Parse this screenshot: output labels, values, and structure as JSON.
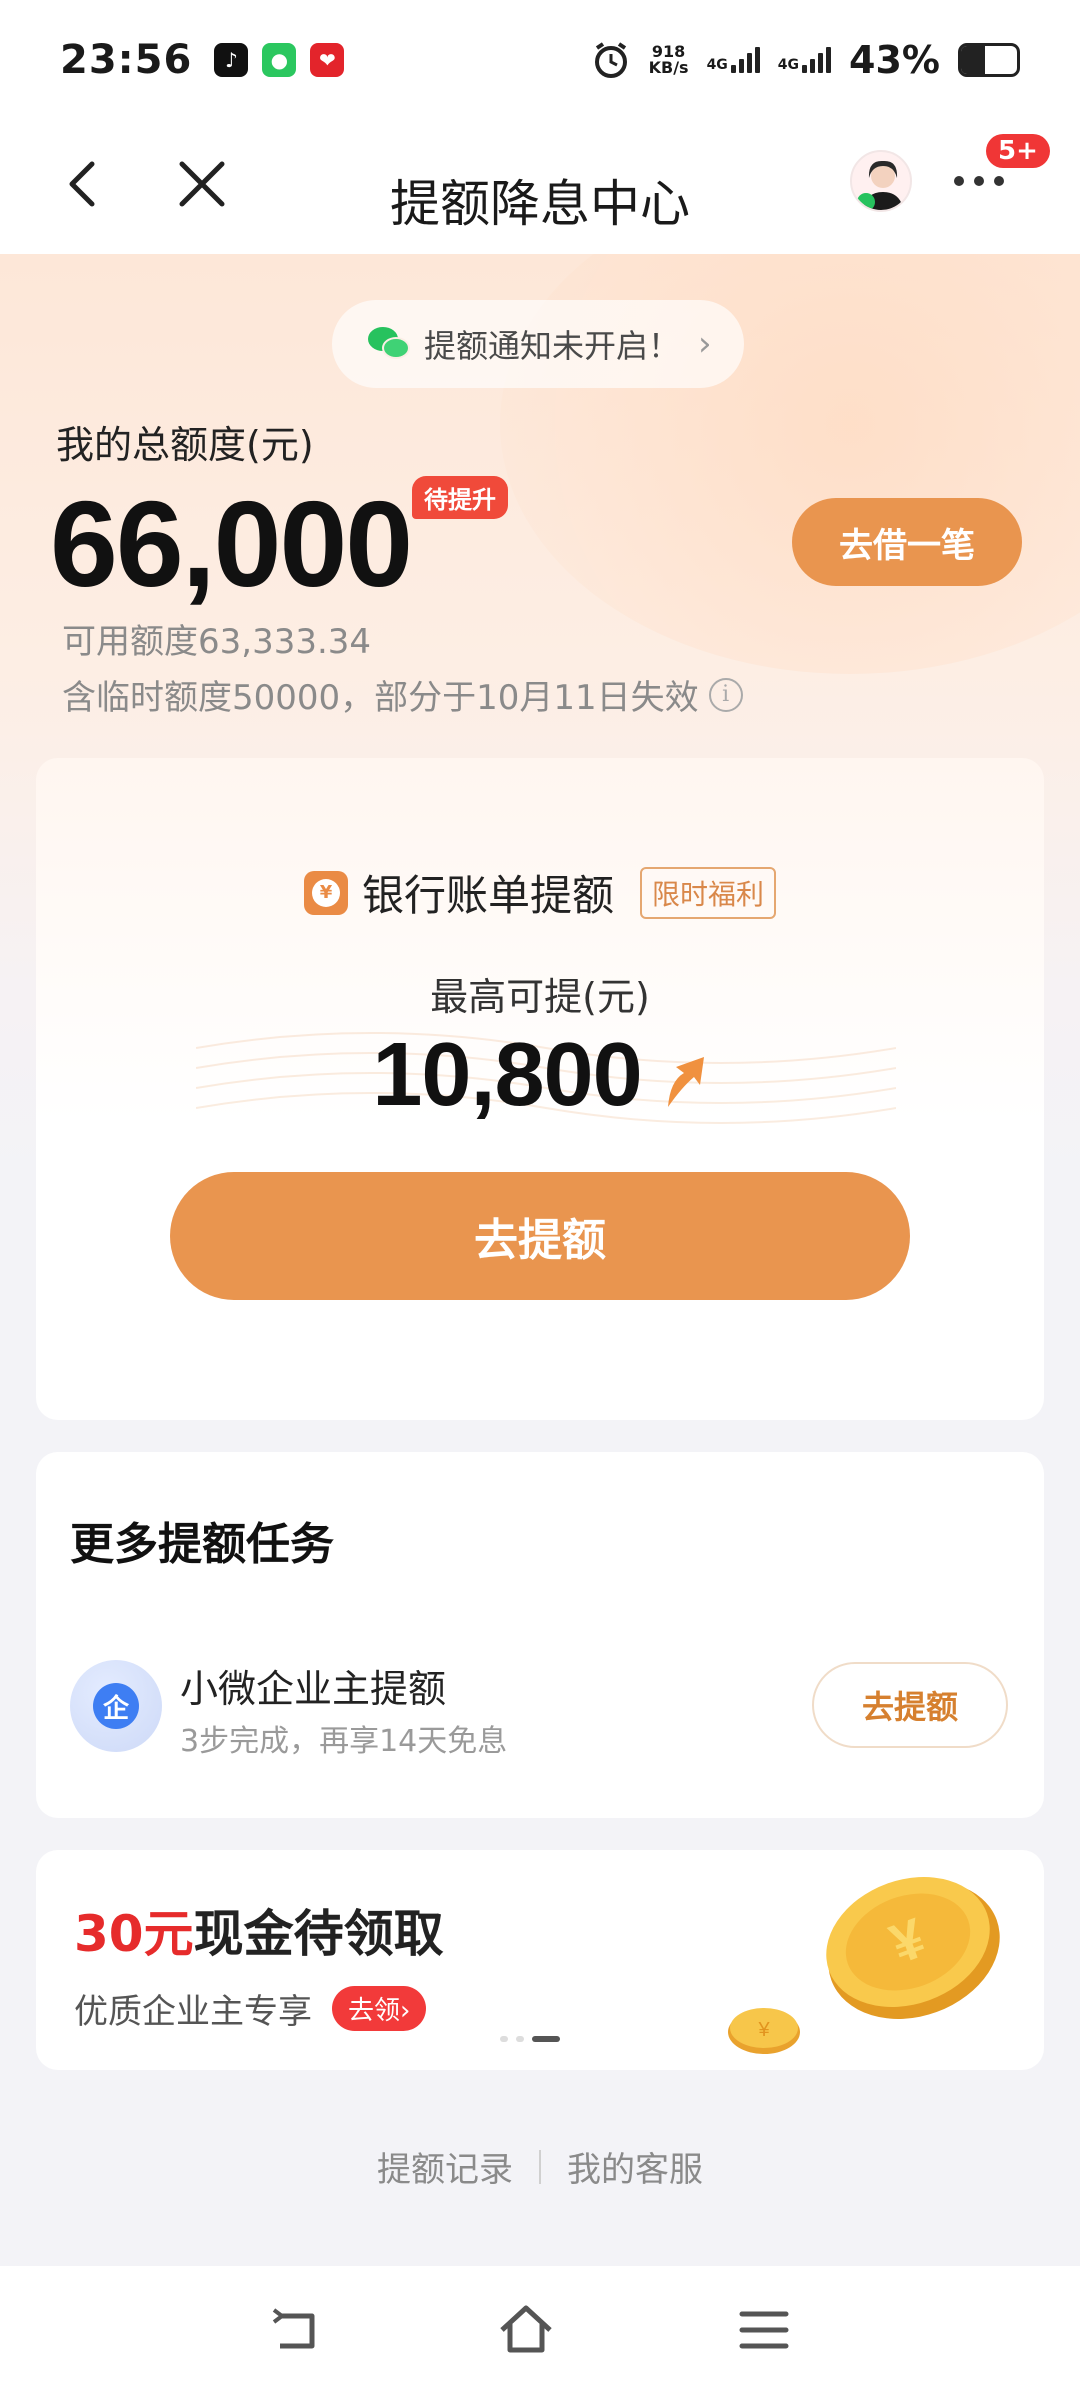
{
  "status_bar": {
    "time": "23:56",
    "net_speed_value": "918",
    "net_speed_unit": "KB/s",
    "network_1": "4G",
    "network_2": "4G",
    "battery_percent": "43%",
    "battery_level": 0.43,
    "app_icons": [
      "douyin-icon",
      "wechat-icon",
      "jd-icon"
    ]
  },
  "nav": {
    "title": "提额降息中心",
    "badge": "5+"
  },
  "hero": {
    "notify_text": "提额通知未开启！",
    "total_label": "我的总额度(元)",
    "total_amount": "66,000",
    "pending_tag": "待提升",
    "borrow_button": "去借一笔",
    "available_line": "可用额度63,333.34",
    "temporary_line": "含临时额度50000，部分于10月11日失效"
  },
  "raise_card": {
    "title": "银行账单提额",
    "limited_tag": "限时福利",
    "max_label": "最高可提(元)",
    "max_amount": "10,800",
    "button": "去提额"
  },
  "tasks_card": {
    "title": "更多提额任务",
    "items": [
      {
        "icon_char": "企",
        "name": "小微企业主提额",
        "desc": "3步完成，再享14天免息",
        "button": "去提额"
      }
    ]
  },
  "banner": {
    "amount_text": "30元",
    "title_rest": "现金待领取",
    "subtitle": "优质企业主专享",
    "claim_pill": "去领›",
    "pager_count": 3,
    "pager_active": 2
  },
  "footer": {
    "link_records": "提额记录",
    "link_service": "我的客服"
  },
  "colors": {
    "accent_orange": "#e9954f",
    "alert_red": "#f03636",
    "wechat_green": "#27c25e",
    "enterprise_blue": "#3e7ef3"
  }
}
